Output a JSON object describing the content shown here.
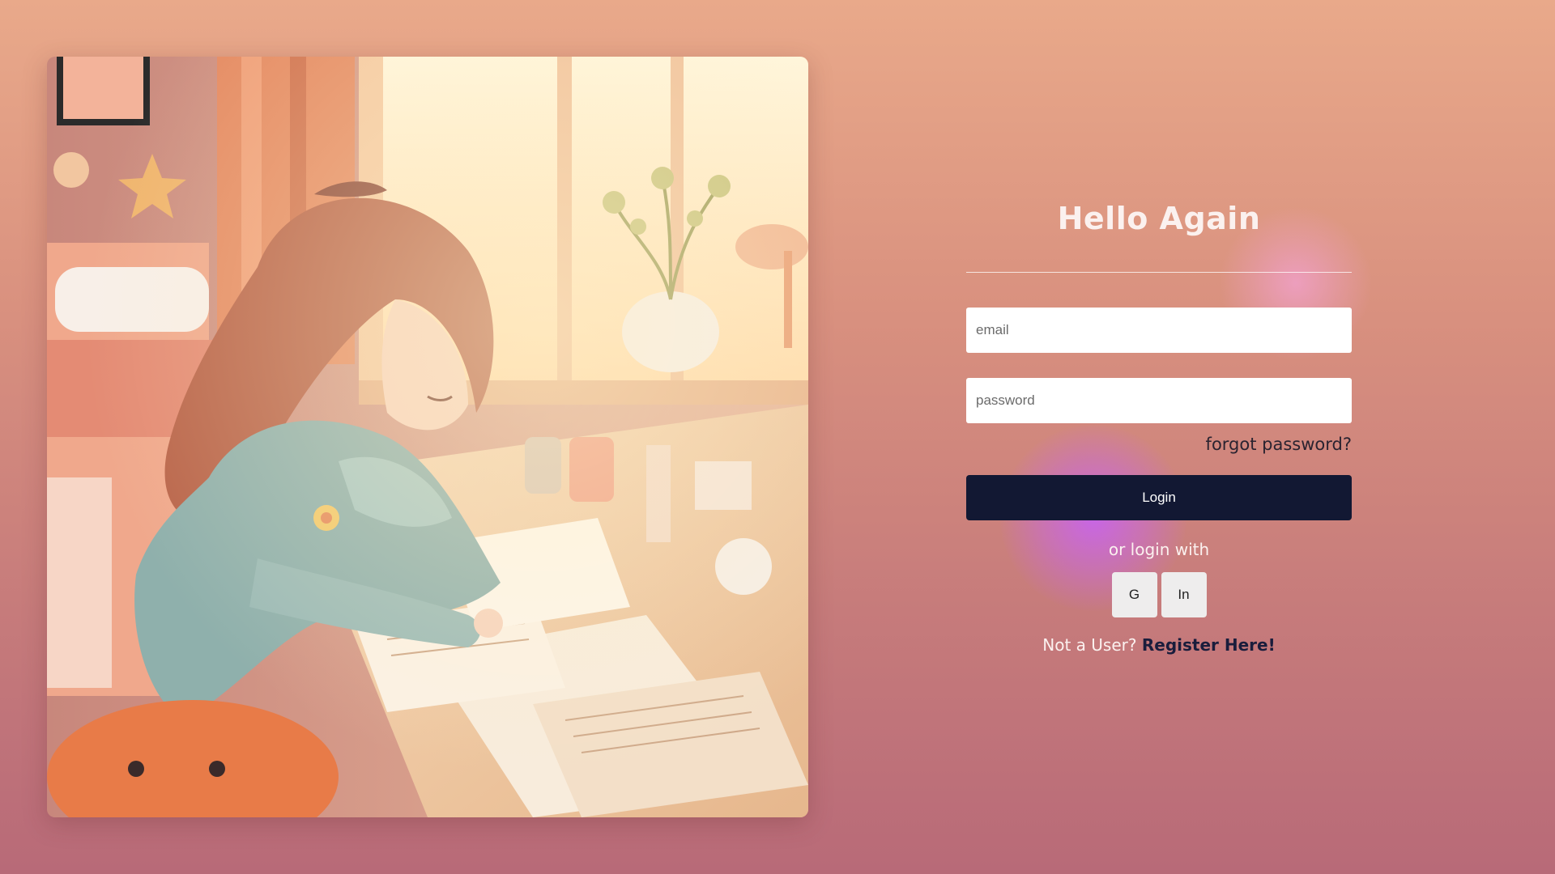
{
  "hero": {
    "illustration": "girl-studying-at-desk-by-window"
  },
  "login": {
    "title": "Hello Again",
    "email_placeholder": "email",
    "password_placeholder": "password",
    "forgot_label": "forgot password?",
    "submit_label": "Login",
    "alt_login_label": "or login with",
    "social_buttons": [
      {
        "label": "G",
        "icon": "google"
      },
      {
        "label": "In",
        "icon": "linkedin"
      }
    ],
    "register_prompt": "Not a User?",
    "register_link": "Register Here!"
  },
  "colors": {
    "button_bg": "#121833",
    "register_link": "#1a1d3c",
    "title": "#fbf1ef",
    "background_top": "#e9a98a",
    "background_bottom": "#b86a78"
  }
}
